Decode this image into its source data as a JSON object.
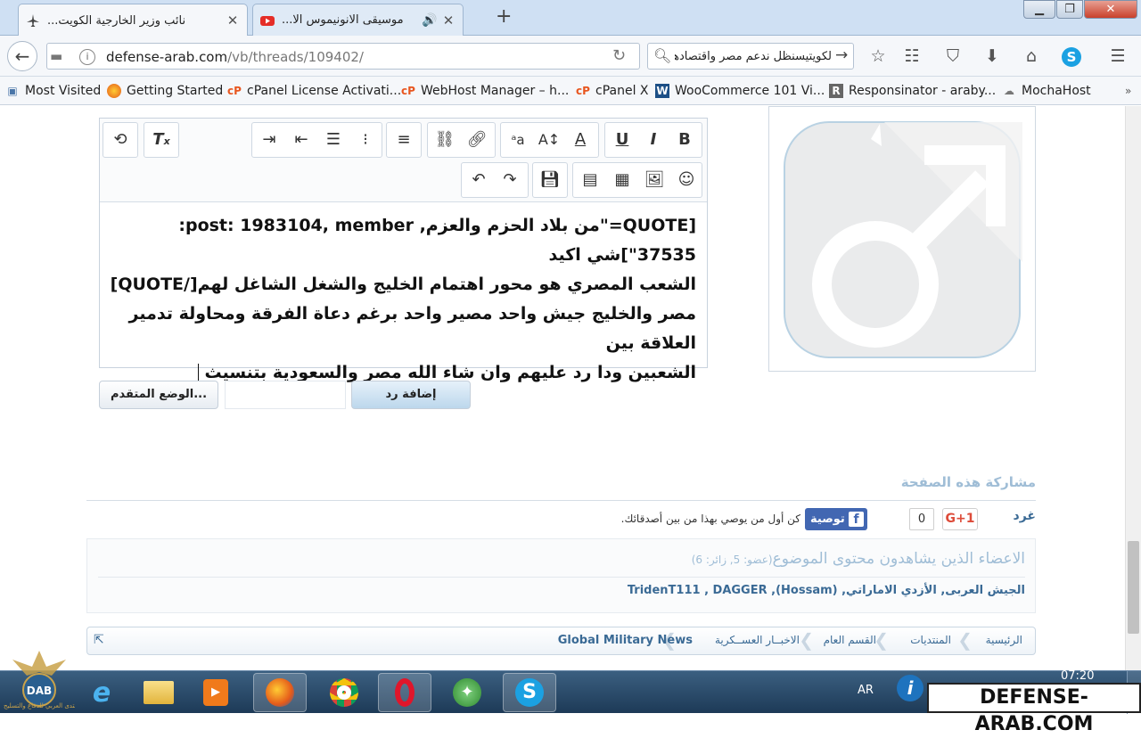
{
  "browser": {
    "tabs": [
      {
        "title": "نائب وزير الخارجية الكويت...",
        "active": true
      },
      {
        "title": "موسيقى الانونيموس الا...",
        "active": false
      }
    ],
    "new_tab": "+",
    "url_host": "defense-arab.com",
    "url_path": "/vb/threads/109402/",
    "search_value": "لكويتيسنظل ندعم مصر واقتصادها :",
    "bookmarks": [
      {
        "label": "Most Visited",
        "icon": "bookmarks-folder-icon"
      },
      {
        "label": "Getting Started",
        "icon": "firefox-icon"
      },
      {
        "label": "cPanel License Activati...",
        "icon": "cpanel-icon"
      },
      {
        "label": "WebHost Manager – h...",
        "icon": "cpanel-icon"
      },
      {
        "label": "cPanel X",
        "icon": "cpanel-icon"
      },
      {
        "label": "WooCommerce 101 Vi...",
        "icon": "wordpress-icon"
      },
      {
        "label": "Responsinator - araby...",
        "icon": "r-icon"
      },
      {
        "label": "MochaHost",
        "icon": "mochahost-icon"
      }
    ]
  },
  "editor": {
    "text_lines": [
      "[QUOTE=\"من بلاد الحزم والعزم, post: 1983104, member:",
      "37535\"]شي اكيد",
      "الشعب المصري هو محور اهتمام الخليج والشغل الشاغل لهم[/QUOTE]",
      "مصر والخليج جيش واحد مصير واحد برغم دعاة الفرقة ومحاولة تدمير العلاقة بين",
      "الشعبين ودا رد عليهم وان شاء الله مصر والسعودية بتنسيث"
    ]
  },
  "actions": {
    "advanced_mode": "الوضع المتقدم...",
    "add_reply": "إضافة رد"
  },
  "share": {
    "heading": "مشاركة هذه الصفحة",
    "tweet": "غرد",
    "gplus_label": "G+1",
    "gplus_count": "0",
    "fb_label": "توصية",
    "fb_text": "كن أول من يوصي بهذا من بين أصدقائك."
  },
  "viewers": {
    "title": "الاعضاء الذين يشاهدون محتوى الموضوع",
    "counts": "(عضو: 5, زائر: 6)",
    "names": "الجيش العربى, الأزدي الاماراتي, (Hossam), TridenT111 , DAGGER"
  },
  "breadcrumb": {
    "items": [
      "الرئيسية",
      "المنتديات",
      "القسم العام",
      "الاخبــار العســكرية",
      "Global Military News"
    ]
  },
  "taskbar": {
    "lang": "AR",
    "time": "07:20"
  },
  "watermark": "DEFENSE-ARAB.COM",
  "logo_text": "المنتدى العربي للدفاع والتسليح"
}
